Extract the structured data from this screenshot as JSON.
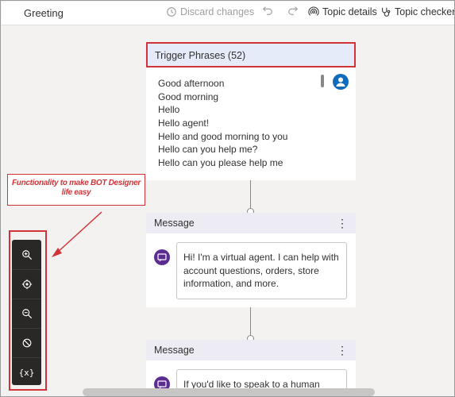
{
  "topbar": {
    "title": "Greeting",
    "discard_label": "Discard changes",
    "topic_details_label": "Topic details",
    "topic_checker_label": "Topic checker"
  },
  "trigger": {
    "header": "Trigger Phrases (52)",
    "phrases": [
      "Good afternoon",
      "Good morning",
      "Hello",
      "Hello agent!",
      "Hello and good morning to you",
      "Hello can you help me?",
      "Hello can you please help me"
    ]
  },
  "messages": [
    {
      "header": "Message",
      "text": "Hi! I'm a virtual agent. I can help with account questions, orders, store information, and more."
    },
    {
      "header": "Message",
      "text": "If you'd like to speak to a human"
    }
  ],
  "annotation": {
    "callout": "Functionality to make BOT Designer life easy"
  },
  "toolbox": {
    "variables_label": "{x}"
  },
  "colors": {
    "accent": "#0f6cbd",
    "annotation_red": "#d13438",
    "message_icon": "#5c2d91",
    "trigger_header_bg": "#e6ebfa",
    "message_header_bg": "#edebf4",
    "toolbox_bg": "#292827"
  },
  "icons": [
    "history-icon",
    "undo-icon",
    "redo-icon",
    "podcast-icon",
    "stethoscope-icon",
    "user-avatar-icon",
    "chat-message-icon",
    "more-icon",
    "zoom-in-icon",
    "recenter-icon",
    "zoom-out-icon",
    "hide-icon"
  ]
}
